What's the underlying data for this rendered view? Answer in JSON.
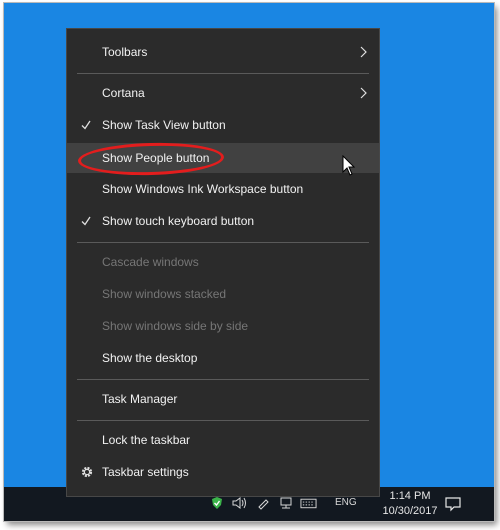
{
  "menu": {
    "toolbars": "Toolbars",
    "cortana": "Cortana",
    "task_view": "Show Task View button",
    "people": "Show People button",
    "ink": "Show Windows Ink Workspace button",
    "touch_kb": "Show touch keyboard button",
    "cascade": "Cascade windows",
    "stacked": "Show windows stacked",
    "side_by_side": "Show windows side by side",
    "desktop": "Show the desktop",
    "task_manager": "Task Manager",
    "lock": "Lock the taskbar",
    "settings": "Taskbar settings"
  },
  "taskbar": {
    "lang": "ENG",
    "time": "1:14 PM",
    "date": "10/30/2017"
  },
  "colors": {
    "desktop": "#1a86e3",
    "menu_bg": "#2b2b2b",
    "highlight_ring": "#e31d1d"
  },
  "icons": [
    "check-icon",
    "chevron-right-icon",
    "gear-icon",
    "mouse-cursor-icon",
    "notification-icon",
    "volume-icon",
    "network-icon"
  ]
}
